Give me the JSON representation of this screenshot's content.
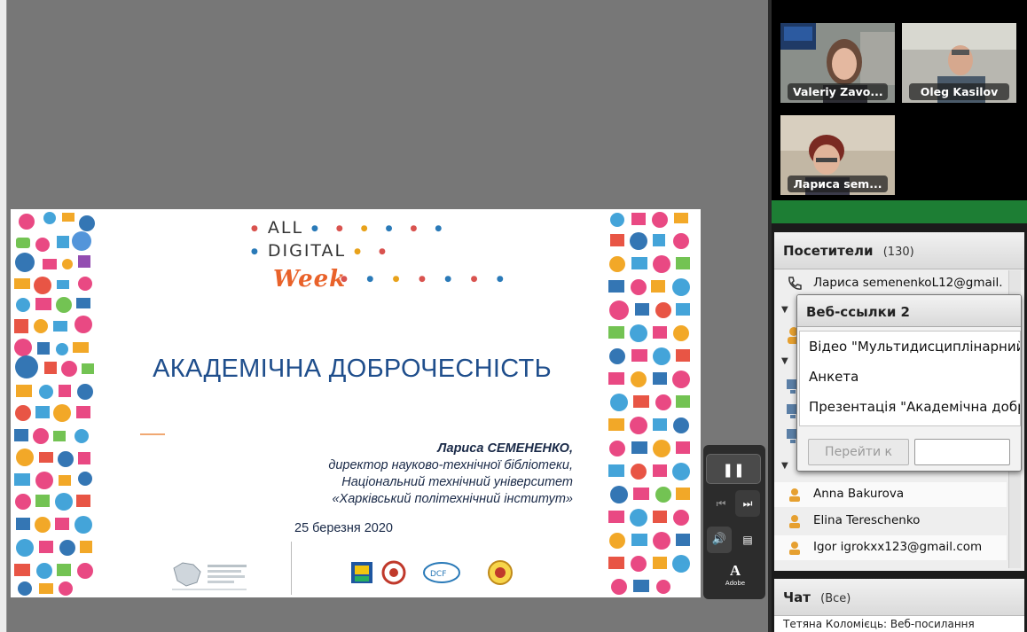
{
  "slide": {
    "brand_row1": "ALL",
    "brand_row2": "DIGITAL",
    "brand_week": "Week",
    "title": "АКАДЕМІЧНА ДОБРОЧЕСНІСТЬ",
    "author_name": "Лариса СЕМЕНЕНКО",
    "author_role": "директор науково-технічної бібліотеки,",
    "author_org1": "Національний технічний університет",
    "author_org2": "«Харківський політехнічний інститут»",
    "date": "25 березня 2020"
  },
  "controls": {
    "pause": "❚❚",
    "prev": "⏮",
    "next": "⏭",
    "volume": "🔊",
    "menu": "▤",
    "adobe_letter": "A",
    "adobe_label": "Adobe"
  },
  "video": {
    "tiles": [
      {
        "name": "Valeriy Zavo..."
      },
      {
        "name": "Oleg Kasilov"
      },
      {
        "name": "Лариса sem..."
      }
    ]
  },
  "attendees": {
    "title": "Посетители",
    "count": "(130)",
    "first": "Лариса semenenkoL12@gmail.c...",
    "rows": [
      {
        "name": "Anna Bakurova"
      },
      {
        "name": "Elina Tereschenko"
      },
      {
        "name": "Igor igrokxx123@gmail.com"
      }
    ]
  },
  "weblinks": {
    "title": "Веб-ссылки 2",
    "items": [
      {
        "label": "Відео \"Мультидисциплінарний"
      },
      {
        "label": "Анкета"
      },
      {
        "label": "Презентація \"Академічна доброчесність\""
      }
    ],
    "go_label": "Перейти к"
  },
  "chat": {
    "title": "Чат",
    "scope": "(Все)",
    "preview": "Тетяна Коломієць: Веб-посилання"
  },
  "colors": {
    "title_blue": "#1f4e8c",
    "week_orange": "#e9622a",
    "presence_green": "#29b34a"
  }
}
